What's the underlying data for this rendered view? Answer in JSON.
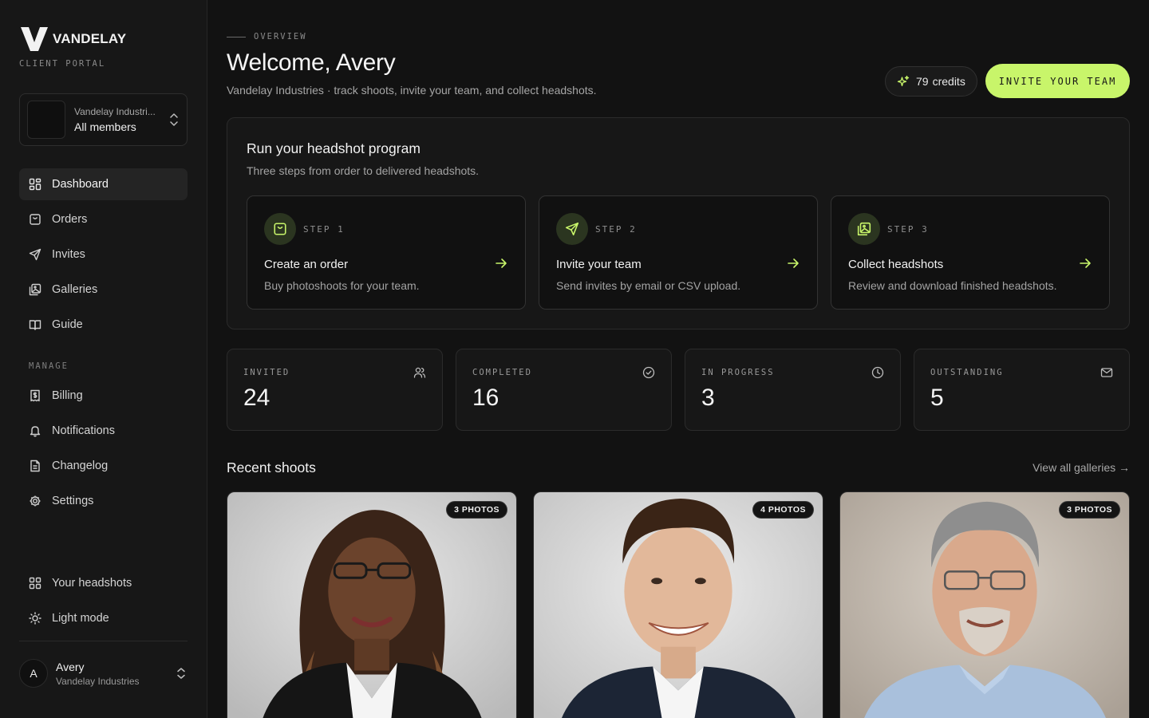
{
  "brand": {
    "name": "VANDELAY",
    "portal_label": "CLIENT PORTAL"
  },
  "org_switcher": {
    "org_name": "Vandelay Industri...",
    "scope": "All members"
  },
  "nav": {
    "items": [
      {
        "label": "Dashboard",
        "icon": "dashboard-icon",
        "active": true
      },
      {
        "label": "Orders",
        "icon": "shopping-bag-icon"
      },
      {
        "label": "Invites",
        "icon": "send-icon"
      },
      {
        "label": "Galleries",
        "icon": "gallery-icon"
      },
      {
        "label": "Guide",
        "icon": "book-icon"
      }
    ],
    "manage_label": "MANAGE",
    "manage_items": [
      {
        "label": "Billing",
        "icon": "billing-icon"
      },
      {
        "label": "Notifications",
        "icon": "bell-icon"
      },
      {
        "label": "Changelog",
        "icon": "document-icon"
      },
      {
        "label": "Settings",
        "icon": "gear-icon"
      }
    ],
    "bottom_items": [
      {
        "label": "Your headshots",
        "icon": "grid-icon"
      },
      {
        "label": "Light mode",
        "icon": "sun-icon"
      }
    ]
  },
  "user": {
    "initial": "A",
    "name": "Avery",
    "org": "Vandelay Industries"
  },
  "header": {
    "eyebrow": "OVERVIEW",
    "title": "Welcome, Avery",
    "subtitle": "Vandelay Industries · track shoots, invite your team, and collect headshots.",
    "credits_value": "79",
    "credits_label": "credits",
    "invite_button": "INVITE YOUR TEAM"
  },
  "program": {
    "title": "Run your headshot program",
    "subtitle": "Three steps from order to delivered headshots.",
    "steps": [
      {
        "step": "STEP 1",
        "title": "Create an order",
        "desc": "Buy photoshoots for your team.",
        "icon": "shopping-bag-icon"
      },
      {
        "step": "STEP 2",
        "title": "Invite your team",
        "desc": "Send invites by email or CSV upload.",
        "icon": "send-icon"
      },
      {
        "step": "STEP 3",
        "title": "Collect headshots",
        "desc": "Review and download finished headshots.",
        "icon": "gallery-icon"
      }
    ]
  },
  "stats": [
    {
      "label": "INVITED",
      "value": "24",
      "icon": "users-icon"
    },
    {
      "label": "COMPLETED",
      "value": "16",
      "icon": "check-circle-icon"
    },
    {
      "label": "IN PROGRESS",
      "value": "3",
      "icon": "clock-icon"
    },
    {
      "label": "OUTSTANDING",
      "value": "5",
      "icon": "mail-icon"
    }
  ],
  "recent": {
    "title": "Recent shoots",
    "view_all": "View all galleries →",
    "shoots": [
      {
        "badge": "3 PHOTOS"
      },
      {
        "badge": "4 PHOTOS"
      },
      {
        "badge": "3 PHOTOS"
      }
    ]
  },
  "colors": {
    "accent": "#c8f56a",
    "background": "#121212",
    "sidebar": "#171717",
    "step_icon_bg": "#2b3520"
  }
}
